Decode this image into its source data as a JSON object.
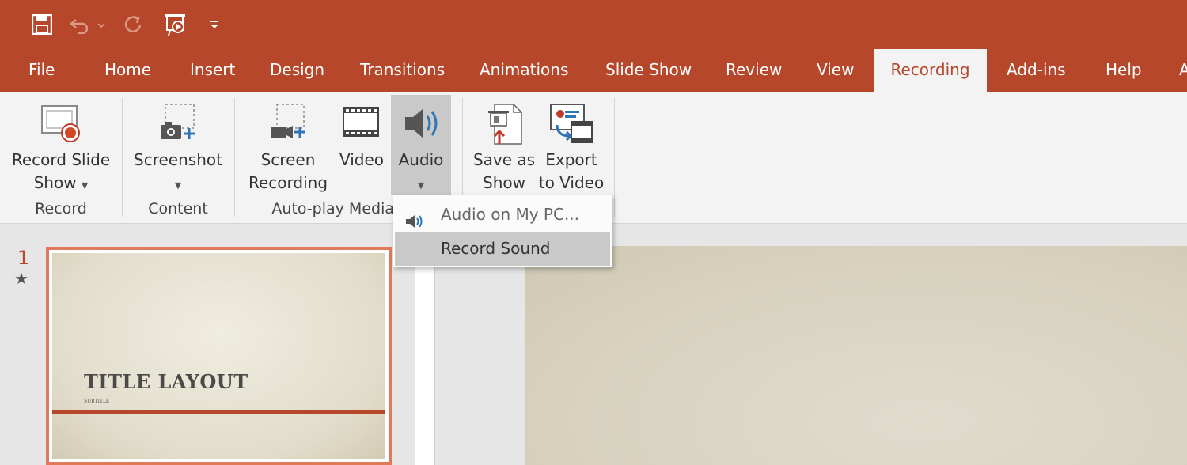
{
  "qat": {
    "save_icon": "save-icon",
    "undo_icon": "undo-icon",
    "redo_icon": "redo-icon",
    "present_icon": "start-from-beginning-icon",
    "customize_icon": "customize-qat-icon"
  },
  "tabs": [
    {
      "label": "File"
    },
    {
      "label": "Home"
    },
    {
      "label": "Insert"
    },
    {
      "label": "Design"
    },
    {
      "label": "Transitions"
    },
    {
      "label": "Animations"
    },
    {
      "label": "Slide Show"
    },
    {
      "label": "Review"
    },
    {
      "label": "View"
    },
    {
      "label": "Recording",
      "active": true
    },
    {
      "label": "Add-ins"
    },
    {
      "label": "Help"
    },
    {
      "label": "A"
    }
  ],
  "ribbon": {
    "record_slide_show": {
      "line1": "Record Slide",
      "line2": "Show"
    },
    "screenshot": {
      "line1": "Screenshot"
    },
    "screen_recording": {
      "line1": "Screen",
      "line2": "Recording"
    },
    "video": {
      "line1": "Video"
    },
    "audio": {
      "line1": "Audio"
    },
    "save_as_show": {
      "line1": "Save as",
      "line2": "Show"
    },
    "export_to_video": {
      "line1": "Export",
      "line2": "to Video"
    },
    "groups": {
      "record": "Record",
      "content": "Content",
      "autoplay": "Auto-play Media"
    }
  },
  "audio_menu": {
    "items": [
      {
        "label": "Audio on My PC...",
        "icon": "speaker-icon"
      },
      {
        "label": "Record Sound",
        "highlighted": true
      }
    ]
  },
  "slides": {
    "number": "1",
    "star": "★",
    "thumb_title": "TITLE LAYOUT",
    "thumb_subtitle": "SUBTITLE"
  },
  "colors": {
    "accent": "#b7472a",
    "ribbon_bg": "#f3f3f3",
    "highlight": "#c9c9c9"
  }
}
